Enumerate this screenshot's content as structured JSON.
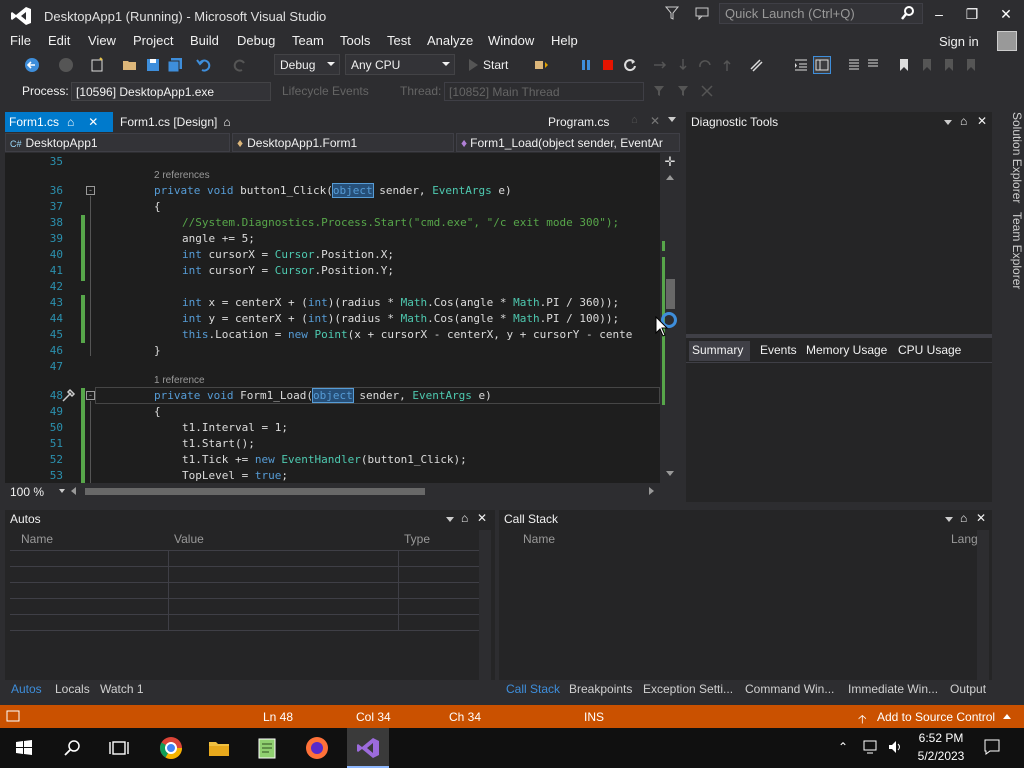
{
  "window": {
    "title": "DesktopApp1 (Running) - Microsoft Visual Studio",
    "quick_launch_placeholder": "Quick Launch (Ctrl+Q)"
  },
  "menu": [
    "File",
    "Edit",
    "View",
    "Project",
    "Build",
    "Debug",
    "Team",
    "Tools",
    "Test",
    "Analyze",
    "Window",
    "Help"
  ],
  "account": {
    "signin": "Sign in"
  },
  "toolbar": {
    "config": "Debug",
    "platform": "Any CPU",
    "start": "Start"
  },
  "process_bar": {
    "process_label": "Process:",
    "process_value": "[10596] DesktopApp1.exe",
    "lifecycle": "Lifecycle Events",
    "thread_label": "Thread:",
    "thread_value": "[10852] Main Thread"
  },
  "doc_tabs": {
    "active": "Form1.cs",
    "design": "Form1.cs [Design]",
    "program": "Program.cs"
  },
  "nav": {
    "project": "DesktopApp1",
    "class": "DesktopApp1.Form1",
    "member": "Form1_Load(object sender, EventAr"
  },
  "editor": {
    "refs_a": "2 references",
    "refs_b": "1 reference",
    "lines": [
      "35",
      "36",
      "37",
      "38",
      "39",
      "40",
      "41",
      "42",
      "43",
      "44",
      "45",
      "46",
      "47",
      "48",
      "49",
      "50",
      "51",
      "52",
      "53"
    ],
    "zoom": "100 %",
    "tokens": {
      "l36a": "private ",
      "l36b": "void ",
      "l36c": "button1_Click(",
      "l36d": "object",
      "l36e": " sender, ",
      "l36f": "EventArgs",
      "l36g": " e)",
      "l37": "{",
      "l38": "//System.Diagnostics.Process.Start(\"cmd.exe\", \"/c exit mode 300\");",
      "l39": "angle += 5;",
      "l40a": "int",
      "l40b": " cursorX = ",
      "l40c": "Cursor",
      "l40d": ".Position.X;",
      "l41a": "int",
      "l41b": " cursorY = ",
      "l41c": "Cursor",
      "l41d": ".Position.Y;",
      "l43a": "int",
      "l43b": " x = centerX + (",
      "l43c": "int",
      "l43d": ")(radius * ",
      "l43e": "Math",
      "l43f": ".Cos(angle * ",
      "l43g": "Math",
      "l43h": ".PI / 360));",
      "l44a": "int",
      "l44b": " y = centerX + (",
      "l44c": "int",
      "l44d": ")(radius * ",
      "l44e": "Math",
      "l44f": ".Cos(angle * ",
      "l44g": "Math",
      "l44h": ".PI / 100));",
      "l45a": "this",
      "l45b": ".Location = ",
      "l45c": "new",
      "l45d": " ",
      "l45e": "Point",
      "l45f": "(x + cursorX - centerX, y + cursorY - cente",
      "l46": "}",
      "l48a": "private ",
      "l48b": "void ",
      "l48c": "Form1_Load(",
      "l48d": "object",
      "l48e": " sender, ",
      "l48f": "EventArgs",
      "l48g": " e)",
      "l49": "{",
      "l50": "t1.Interval = 1;",
      "l51": "t1.Start();",
      "l52a": "t1.Tick += ",
      "l52b": "new",
      "l52c": " ",
      "l52d": "EventHandler",
      "l52e": "(button1_Click);",
      "l53a": "TopLevel = ",
      "l53b": "true",
      "l53c": ";"
    }
  },
  "diagnostic": {
    "title": "Diagnostic Tools",
    "tabs": [
      "Summary",
      "Events",
      "Memory Usage",
      "CPU Usage"
    ]
  },
  "right_sidebar": [
    "Solution Explorer",
    "Team Explorer"
  ],
  "autos": {
    "title": "Autos",
    "cols": [
      "Name",
      "Value",
      "Type"
    ],
    "tabs": [
      "Autos",
      "Locals",
      "Watch 1"
    ]
  },
  "callstack": {
    "title": "Call Stack",
    "cols": [
      "Name",
      "Lang"
    ],
    "tabs": [
      "Call Stack",
      "Breakpoints",
      "Exception Setti...",
      "Command Win...",
      "Immediate Win...",
      "Output"
    ]
  },
  "status": {
    "ln": "Ln 48",
    "col": "Col 34",
    "ch": "Ch 34",
    "ins": "INS",
    "source_control": "Add to Source Control"
  },
  "taskbar": {
    "time": "6:52 PM",
    "date": "5/2/2023"
  },
  "colors": {
    "accent": "#007acc",
    "status": "#ca5100",
    "keyword": "#569cd6",
    "type": "#4ec9b0",
    "comment": "#57a64a"
  }
}
